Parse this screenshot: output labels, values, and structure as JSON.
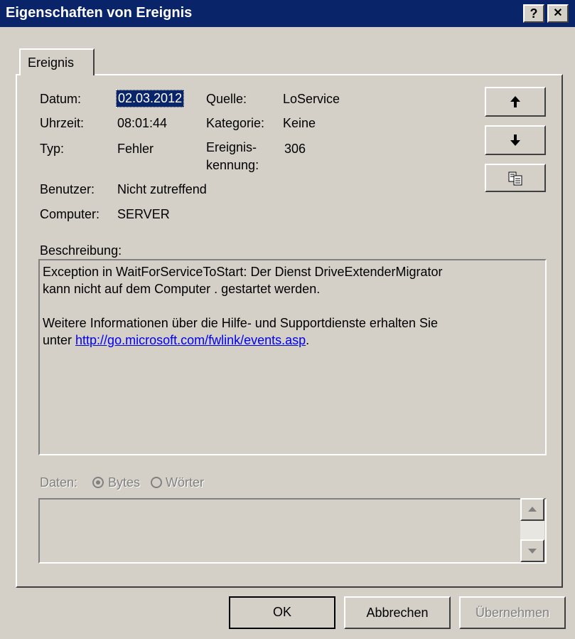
{
  "window": {
    "title": "Eigenschaften von Ereignis",
    "help_glyph": "?",
    "close_glyph": "✕"
  },
  "tabs": [
    {
      "label": "Ereignis"
    }
  ],
  "fields": {
    "datum_label": "Datum:",
    "datum_value": "02.03.2012",
    "uhrzeit_label": "Uhrzeit:",
    "uhrzeit_value": "08:01:44",
    "typ_label": "Typ:",
    "typ_value": "Fehler",
    "benutzer_label": "Benutzer:",
    "benutzer_value": "Nicht zutreffend",
    "computer_label": "Computer:",
    "computer_value": "SERVER",
    "quelle_label": "Quelle:",
    "quelle_value": "LoService",
    "kategorie_label": "Kategorie:",
    "kategorie_value": "Keine",
    "ereignis_label_1": "Ereignis-",
    "ereignis_label_2": "kennung:",
    "ereignis_value": "306"
  },
  "description": {
    "label": "Beschreibung:",
    "line1": "Exception in WaitForServiceToStart: Der Dienst DriveExtenderMigrator",
    "line2": "kann nicht auf dem Computer . gestartet werden.",
    "line3": "Weitere Informationen über die Hilfe- und Supportdienste erhalten Sie",
    "line4_prefix": "unter ",
    "link": "http://go.microsoft.com/fwlink/events.asp",
    "line4_suffix": "."
  },
  "data_section": {
    "label": "Daten:",
    "option_bytes": "Bytes",
    "option_words": "Wörter",
    "selected": "Bytes"
  },
  "side_buttons": {
    "up_icon": "arrow-up-icon",
    "down_icon": "arrow-down-icon",
    "copy_icon": "copy-icon"
  },
  "buttons": {
    "ok": "OK",
    "cancel": "Abbrechen",
    "apply": "Übernehmen"
  },
  "colors": {
    "titlebar": "#0a246a",
    "face": "#d4d0c8",
    "selection": "#0a246a",
    "link": "#0000ee"
  }
}
